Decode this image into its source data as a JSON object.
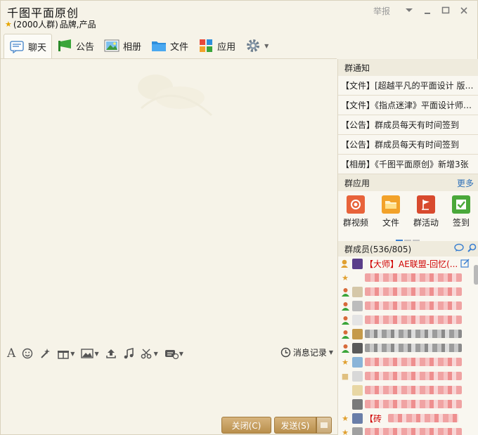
{
  "window": {
    "title": "千图平面原创",
    "group_size": "(2000人群)",
    "tags": "品牌,产品",
    "report_label": "举报"
  },
  "tabs": [
    {
      "label": "聊天",
      "icon": "chat-bubble-icon"
    },
    {
      "label": "公告",
      "icon": "megaphone-icon"
    },
    {
      "label": "相册",
      "icon": "photo-album-icon"
    },
    {
      "label": "文件",
      "icon": "folder-icon"
    },
    {
      "label": "应用",
      "icon": "apps-grid-icon"
    }
  ],
  "input_toolbar": {
    "history_label": "消息记录",
    "icons": [
      "font-icon",
      "emoji-icon",
      "magic-wand-icon",
      "gift-icon",
      "image-icon",
      "upload-icon",
      "music-icon",
      "scissors-icon",
      "screenshot-icon"
    ]
  },
  "buttons": {
    "close_label": "关闭(C)",
    "send_label": "发送(S)"
  },
  "notices": {
    "header": "群通知",
    "items": [
      "【文件】[超越平凡的平面设计 版式设计原理与应用].pdf",
      "【文件】《指点迷津》平面设计师必读.pdf",
      "【公告】群成员每天有时间签到",
      "【公告】群成员每天有时间签到",
      "【相册】《千图平面原创》新增3张"
    ]
  },
  "group_apps": {
    "header": "群应用",
    "more_label": "更多",
    "items": [
      {
        "label": "群视频",
        "icon": "video-icon",
        "color": "#e8633a"
      },
      {
        "label": "文件",
        "icon": "folder-icon",
        "color": "#f2a22a"
      },
      {
        "label": "群活动",
        "icon": "flag-icon",
        "color": "#d84a2e"
      },
      {
        "label": "签到",
        "icon": "checkbox-icon",
        "color": "#4aa83a"
      }
    ]
  },
  "members": {
    "header": "群成员",
    "count": "(536/805)",
    "first_member": "【大师】AE联盟-回忆(...",
    "partial_member": "【砖"
  },
  "colors": {
    "accent": "#b98f4c",
    "link": "#2d6fb8",
    "member_name": "#d00000"
  }
}
